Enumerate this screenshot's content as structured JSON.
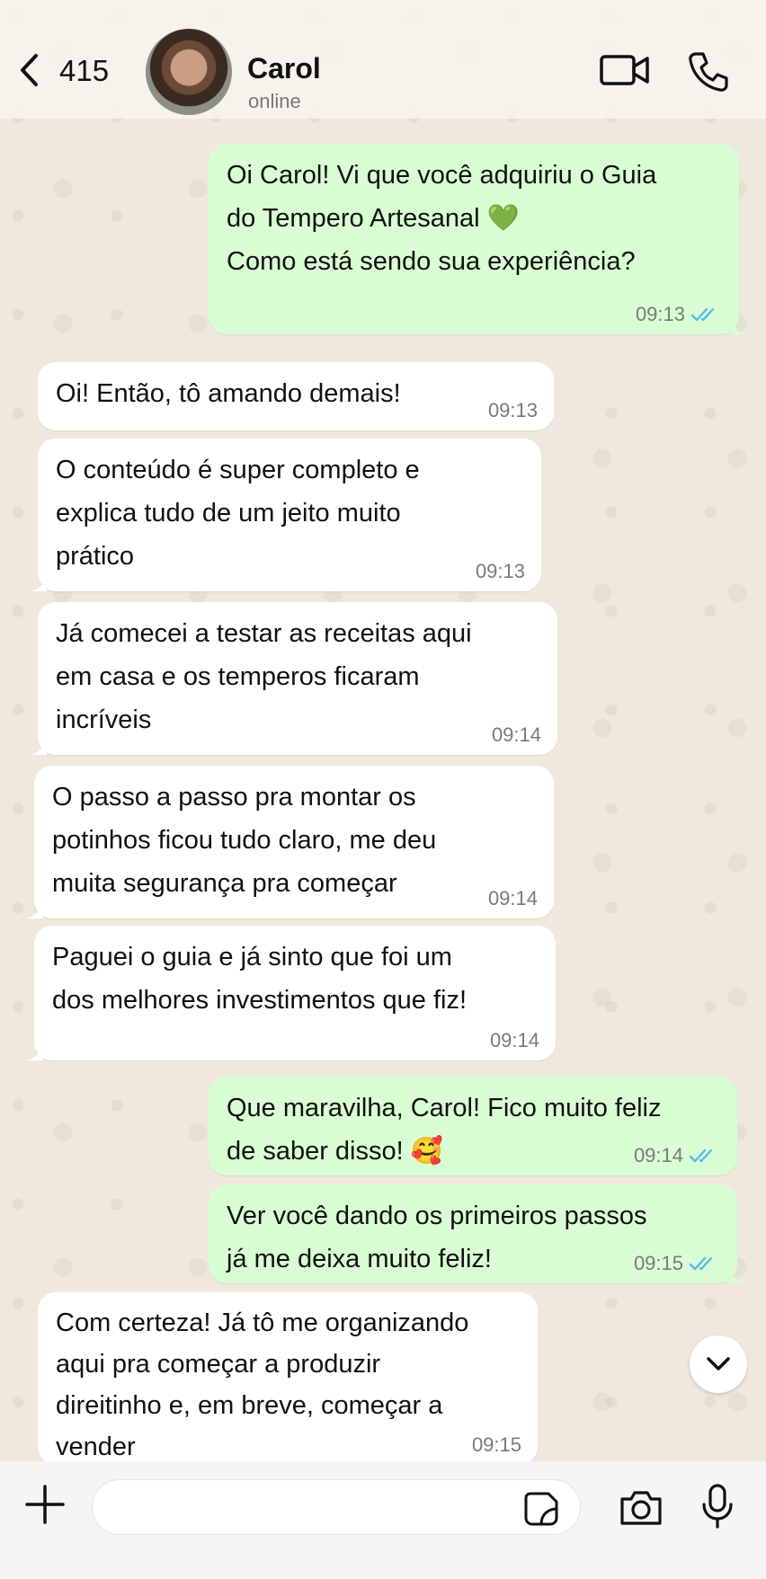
{
  "header": {
    "back_count": "415",
    "contact_name": "Carol",
    "contact_status": "online"
  },
  "messages": [
    {
      "direction": "out",
      "text": "Oi Carol! Vi que você adquiriu o Guia\ndo Tempero Artesanal 💚\nComo está sendo sua experiência?",
      "time": "09:13",
      "read": true
    },
    {
      "direction": "in",
      "text": "Oi! Então, tô amando demais!",
      "time": "09:13"
    },
    {
      "direction": "in",
      "text": "O conteúdo é super completo e\nexplica tudo de um jeito muito\nprático",
      "time": "09:13"
    },
    {
      "direction": "in",
      "text": "Já comecei a testar as receitas aqui\nem casa e os temperos ficaram\nincríveis",
      "time": "09:14"
    },
    {
      "direction": "in",
      "text": "O passo a passo pra montar os\npotinhos ficou tudo claro, me deu\nmuita segurança pra começar",
      "time": "09:14"
    },
    {
      "direction": "in",
      "text": "Paguei o guia e já sinto que foi um\ndos melhores investimentos que fiz!",
      "time": "09:14"
    },
    {
      "direction": "out",
      "text": "Que maravilha, Carol! Fico muito feliz\nde saber disso! 🥰",
      "time": "09:14",
      "read": true
    },
    {
      "direction": "out",
      "text": "Ver você dando os primeiros passos\njá me deixa muito feliz!",
      "time": "09:15",
      "read": true
    },
    {
      "direction": "in",
      "text": "Com certeza! Já tô me organizando\naqui pra começar a produzir\ndireitinho e, em breve, começar a\nvender",
      "time": "09:15"
    }
  ],
  "composer": {
    "input_value": ""
  },
  "colors": {
    "outgoing_bubble": "#d9fdd3",
    "incoming_bubble": "#ffffff",
    "read_ticks": "#53bdeb"
  }
}
